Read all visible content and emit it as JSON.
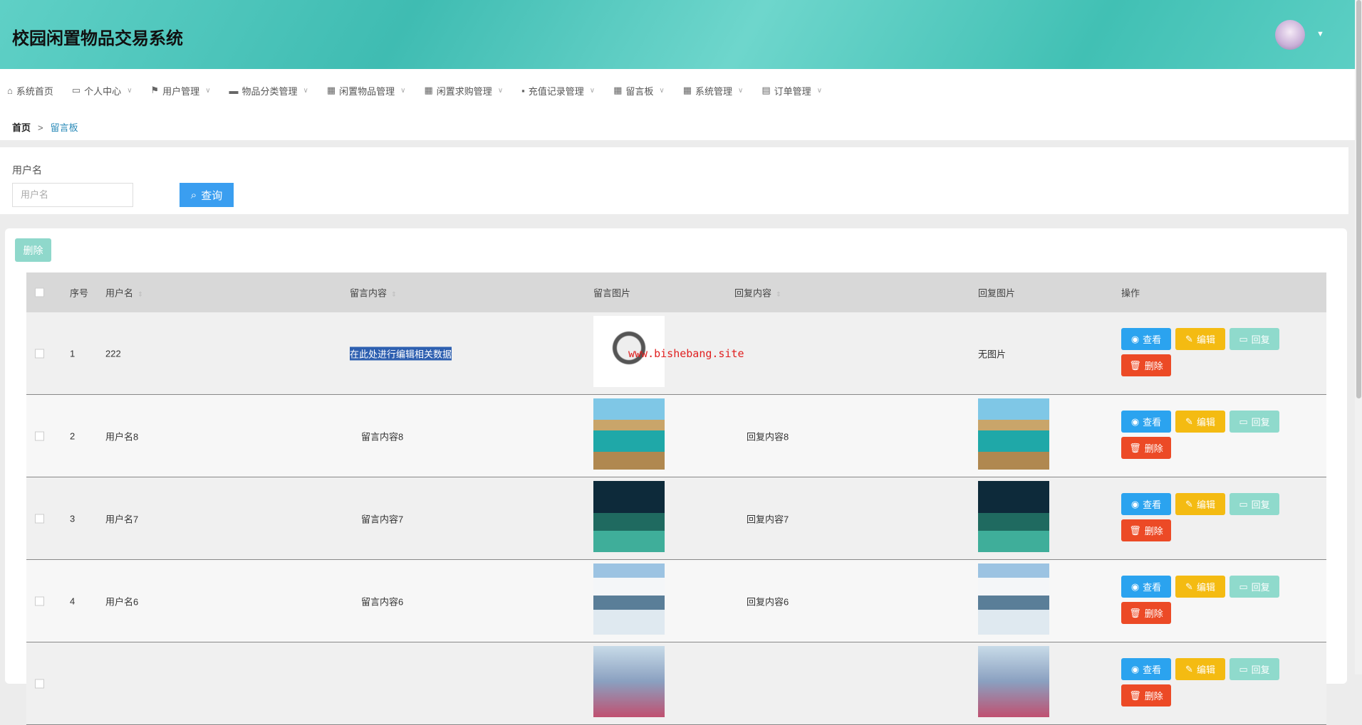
{
  "header": {
    "title": "校园闲置物品交易系统"
  },
  "nav": [
    {
      "label": "系统首页",
      "icon": "home-icon",
      "chev": false
    },
    {
      "label": "个人中心",
      "icon": "card-icon",
      "chev": true
    },
    {
      "label": "用户管理",
      "icon": "flag-icon",
      "chev": true
    },
    {
      "label": "物品分类管理",
      "icon": "ticket-icon",
      "chev": true
    },
    {
      "label": "闲置物品管理",
      "icon": "grid-icon",
      "chev": true
    },
    {
      "label": "闲置求购管理",
      "icon": "grid-icon",
      "chev": true
    },
    {
      "label": "充值记录管理",
      "icon": "message-icon",
      "chev": true
    },
    {
      "label": "留言板",
      "icon": "grid-icon",
      "chev": true
    },
    {
      "label": "系统管理",
      "icon": "grid-icon",
      "chev": true
    },
    {
      "label": "订单管理",
      "icon": "briefcase-icon",
      "chev": true
    }
  ],
  "breadcrumb": {
    "home": "首页",
    "sep": ">",
    "current": "留言板"
  },
  "search": {
    "label": "用户名",
    "placeholder": "用户名",
    "button": "查询"
  },
  "toolbar": {
    "delete": "删除"
  },
  "table": {
    "headers": {
      "index": "序号",
      "username": "用户名",
      "content": "留言内容",
      "image": "留言图片",
      "reply": "回复内容",
      "reply_image": "回复图片",
      "actions": "操作"
    },
    "rows": [
      {
        "index": "1",
        "username": "222",
        "content": "在此处进行编辑相关数据",
        "image": "watch",
        "reply": "",
        "reply_image_text": "无图片",
        "watermark": "www.bishebang.site"
      },
      {
        "index": "2",
        "username": "用户名8",
        "content": "留言内容8",
        "image": "sea",
        "reply": "回复内容8",
        "reply_image_text": ""
      },
      {
        "index": "3",
        "username": "用户名7",
        "content": "留言内容7",
        "image": "night",
        "reply": "回复内容7",
        "reply_image_text": ""
      },
      {
        "index": "4",
        "username": "用户名6",
        "content": "留言内容6",
        "image": "mountain",
        "reply": "回复内容6",
        "reply_image_text": ""
      },
      {
        "index": "",
        "username": "",
        "content": "",
        "image": "flower",
        "reply": "",
        "reply_image_text": ""
      }
    ],
    "actions": {
      "view": "查看",
      "edit": "编辑",
      "reply": "回复",
      "delete": "删除"
    }
  }
}
